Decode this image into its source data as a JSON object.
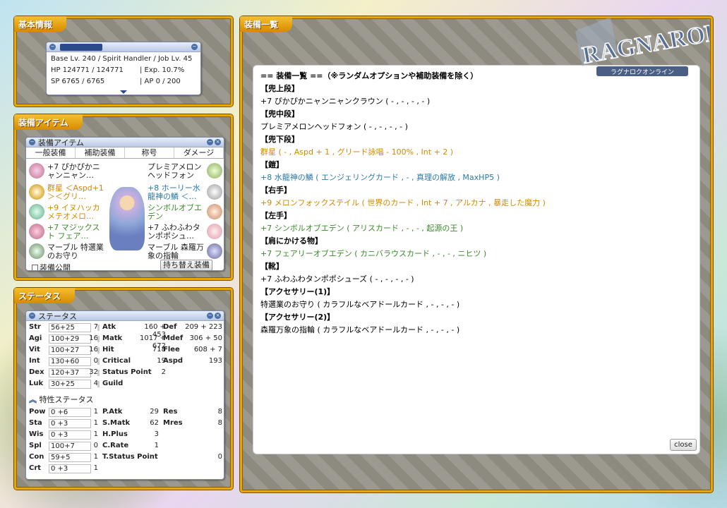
{
  "basic": {
    "panel_title": "基本情報",
    "line1": "Base Lv. 240 / Spirit Handler / Job Lv. 45",
    "hp": "HP 124771 / 124771",
    "exp": "| Exp. 10.7%",
    "sp": "SP 6765 / 6765",
    "ap": "| AP 0 / 200"
  },
  "equip_panel": {
    "panel_title": "装備アイテム",
    "window_title": "装備アイテム",
    "tabs": [
      "一般装備",
      "補助装備",
      "称号",
      "ダメージ"
    ],
    "left": [
      "+7 ぴかぴかニャンニャン…",
      "群星 ＜Aspd+1＞＜グリ…",
      "+9 イヌハッカメテオメロ…",
      "+7 マジックスト フェア…",
      "マーブル 特選業のお守り"
    ],
    "right": [
      "プレミアメロンヘッドフォン",
      "+8 ホーリー水龍神の鱗 ＜…",
      "シンボルオブエデン",
      "+7 ふわふわタンポポシュ…",
      "マーブル 森羅万象の指輪"
    ],
    "public_label": "装備公開",
    "switch_label": "持ち替え装備"
  },
  "status": {
    "panel_title": "ステータス",
    "window_title": "ステータス",
    "base": [
      [
        "Str",
        "56+25",
        "7"
      ],
      [
        "Agi",
        "100+29",
        "16"
      ],
      [
        "Vit",
        "100+27",
        "16"
      ],
      [
        "Int",
        "130+60",
        "0"
      ],
      [
        "Dex",
        "120+37",
        "32"
      ],
      [
        "Luk",
        "30+25",
        "4"
      ]
    ],
    "mid": [
      [
        "Atk",
        "160 + 453"
      ],
      [
        "Matk",
        "1017 + 672"
      ],
      [
        "Hit",
        "718"
      ],
      [
        "Critical",
        "19"
      ],
      [
        "Status Point",
        "2"
      ],
      [
        "Guild",
        ""
      ]
    ],
    "right": [
      [
        "Def",
        "209 + 223"
      ],
      [
        "Mdef",
        "306 + 50"
      ],
      [
        "Flee",
        "608 + 7"
      ],
      [
        "Aspd",
        "193"
      ]
    ],
    "trait_title": "特性ステータス",
    "trait": [
      [
        "Pow",
        "0 +6",
        "1"
      ],
      [
        "Sta",
        "0 +3",
        "1"
      ],
      [
        "Wis",
        "0 +3",
        "1"
      ],
      [
        "Spl",
        "100+7",
        "0"
      ],
      [
        "Con",
        "59+5",
        "1"
      ],
      [
        "Crt",
        "0 +3",
        "1"
      ]
    ],
    "tmid": [
      [
        "P.Atk",
        "29"
      ],
      [
        "S.Matk",
        "62"
      ],
      [
        "H.Plus",
        "3"
      ],
      [
        "C.Rate",
        "1"
      ],
      [
        "T.Status Point",
        "0"
      ]
    ],
    "tright": [
      [
        "Res",
        "8"
      ],
      [
        "Mres",
        "8"
      ]
    ]
  },
  "list": {
    "panel_title": "装備一覧",
    "lines": [
      {
        "t": "== 装備一覧 ==（※ランダムオプションや補助装備を除く）",
        "c": "#000",
        "b": true
      },
      {
        "t": "【兜上段】",
        "c": "#000",
        "b": true
      },
      {
        "t": "+7 ぴかぴかニャンニャンクラウン ( - , - , - , - )",
        "c": "#000"
      },
      {
        "t": "【兜中段】",
        "c": "#000",
        "b": true
      },
      {
        "t": "プレミアメロンヘッドフォン ( - , - , - , - )",
        "c": "#000"
      },
      {
        "t": "【兜下段】",
        "c": "#000",
        "b": true
      },
      {
        "t": "群星 ( - , Aspd + 1 , グリード詠唱 - 100% , Int + 2 )",
        "c": "#d08a00"
      },
      {
        "t": "【鎧】",
        "c": "#000",
        "b": true
      },
      {
        "t": "+8 水龍神の鱗 ( エンジェリングカード , - , 真理の解放 , MaxHP5 )",
        "c": "#2a7aa8"
      },
      {
        "t": "【右手】",
        "c": "#000",
        "b": true
      },
      {
        "t": "+9 メロンフォックステイル ( 世界のカード , Int + 7 , アルカナ , 暴走した魔力 )",
        "c": "#d08a00"
      },
      {
        "t": "【左手】",
        "c": "#000",
        "b": true
      },
      {
        "t": "+7 シンボルオブエデン ( アリスカード , - , - , 起源の王 )",
        "c": "#3a8a2a"
      },
      {
        "t": "【肩にかける物】",
        "c": "#000",
        "b": true
      },
      {
        "t": "+7 フェアリーオブエデン ( カニバラウスカード , - , - , ニヒツ )",
        "c": "#3a8a2a"
      },
      {
        "t": "【靴】",
        "c": "#000",
        "b": true
      },
      {
        "t": "+7 ふわふわタンポポシューズ ( - , - , - , - )",
        "c": "#000"
      },
      {
        "t": "【アクセサリー(1)】",
        "c": "#000",
        "b": true
      },
      {
        "t": "特選業のお守り ( カラフルなベアドールカード , - , - , - )",
        "c": "#000"
      },
      {
        "t": "【アクセサリー(2)】",
        "c": "#000",
        "b": true
      },
      {
        "t": "森羅万象の指輪 ( カラフルなベアドールカード , - , - , - )",
        "c": "#000"
      }
    ],
    "close_label": "close"
  },
  "logo": {
    "text": "RAGNAROK",
    "sub": "ラグナロクオンライン"
  }
}
